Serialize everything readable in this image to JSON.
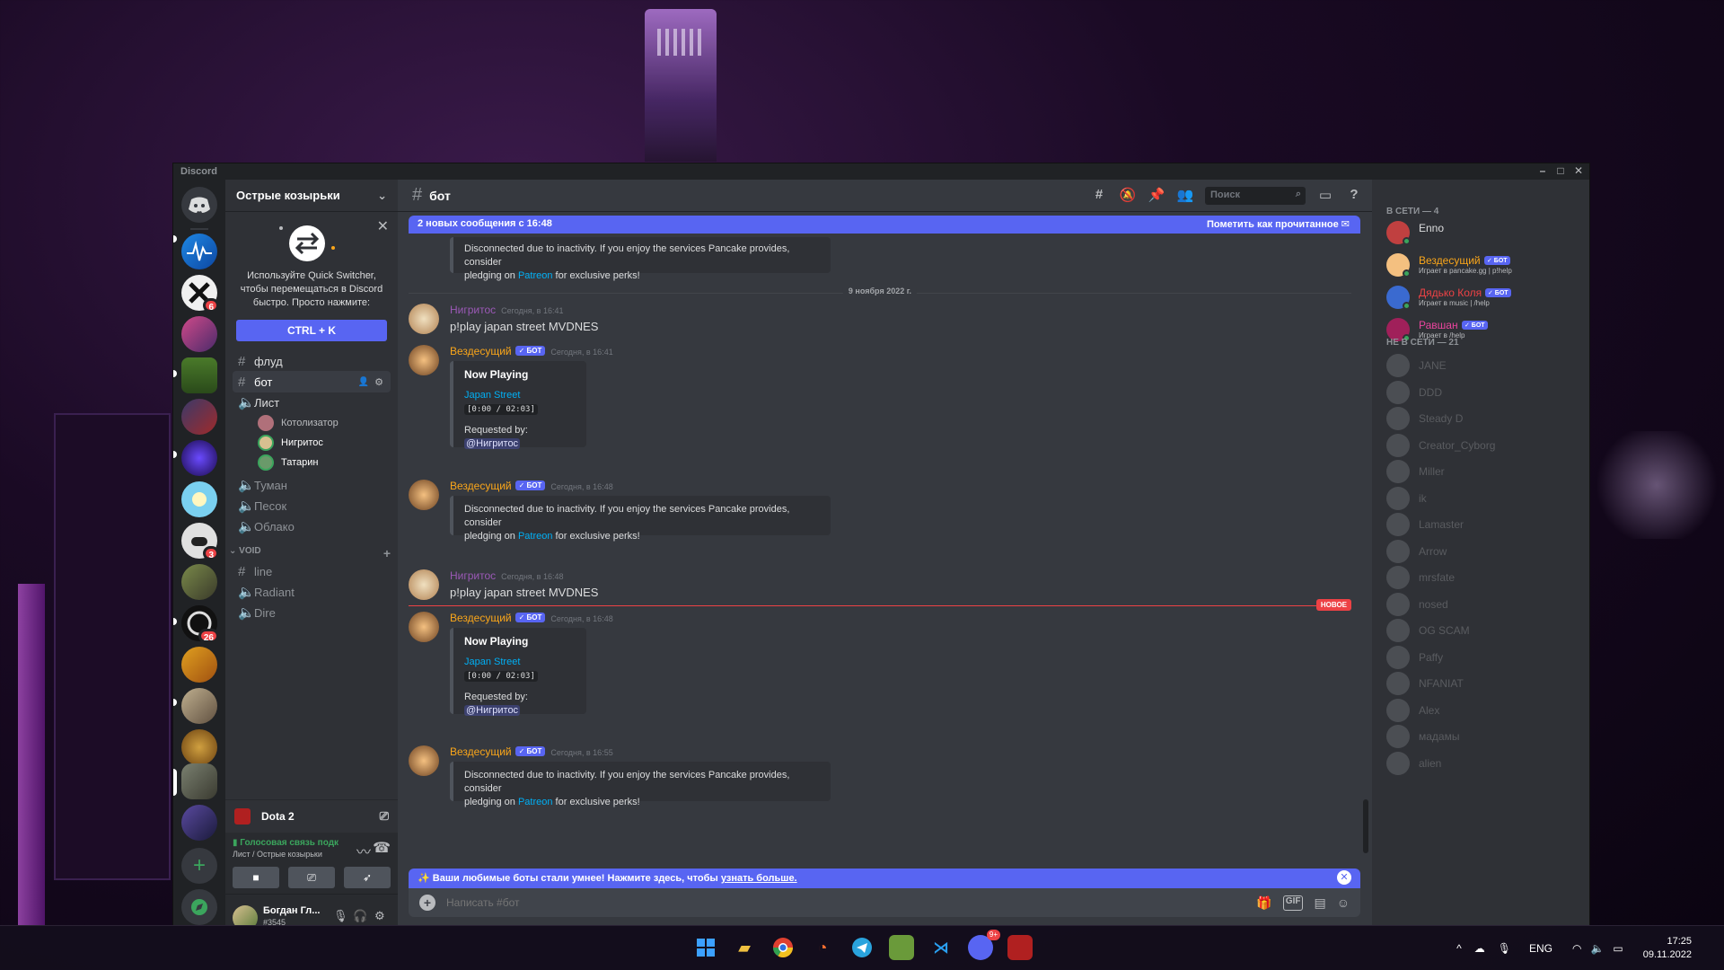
{
  "window": {
    "app_name": "Discord"
  },
  "server": {
    "name": "Острые козырьки",
    "quick_switcher": {
      "text": "Используйте Quick Switcher, чтобы перемещаться в Discord быстро. Просто нажмите:",
      "shortcut": "CTRL + K"
    },
    "channels": {
      "flood": "флуд",
      "bot": "бот",
      "list": "Лист",
      "voice_users": [
        "Котолизатор",
        "Нигритос",
        "Татарин"
      ],
      "fog": "Туман",
      "sand": "Песок",
      "cloud": "Облако"
    },
    "category_void": "VOID",
    "void_channels": [
      "line",
      "Radiant",
      "Dire"
    ]
  },
  "server_badges": {
    "s3": "6",
    "s9": "3",
    "s11": "26"
  },
  "activity": {
    "game": "Dota 2"
  },
  "voice": {
    "status": "Голосовая связь подк",
    "location": "Лист / Острые козырьки"
  },
  "user": {
    "name": "Богдан Гл...",
    "tag": "#3545"
  },
  "chat": {
    "channel": "бот",
    "search_placeholder": "Поиск",
    "new_messages_bar": "2 новых сообщения с 16:48",
    "mark_read": "Пометить как прочитанное",
    "date_divider": "9 ноября 2022 г.",
    "new_label": "НОВОЕ",
    "bot_tag": "✓ БОТ",
    "inactivity_text_1": "Disconnected due to inactivity. If you enjoy the services Pancake provides, consider",
    "inactivity_text_2a": "pledging on",
    "inactivity_link": "Patreon",
    "inactivity_text_2b": "for exclusive perks!",
    "now_playing": "Now Playing",
    "track": "Japan Street",
    "progress": "[0:00 / 02:03]",
    "requested_by": "Requested by:",
    "requester": "@Нигритос",
    "messages": [
      {
        "author": "Нигритос",
        "time": "Сегодня, в 16:41",
        "text": "p!play japan street MVDNES"
      },
      {
        "author": "Вездесущий",
        "time": "Сегодня, в 16:41"
      },
      {
        "author": "Вездесущий",
        "time": "Сегодня, в 16:48"
      },
      {
        "author": "Нигритос",
        "time": "Сегодня, в 16:48",
        "text": "p!play japan street MVDNES"
      },
      {
        "author": "Вездесущий",
        "time": "Сегодня, в 16:48"
      },
      {
        "author": "Вездесущий",
        "time": "Сегодня, в 16:55"
      }
    ],
    "promo_text": "Ваши любимые боты стали умнее! Нажмите здесь, чтобы",
    "promo_link": "узнать больше.",
    "composer_placeholder": "Написать #бот"
  },
  "members": {
    "online_header": "В СЕТИ — 4",
    "offline_header": "НЕ В СЕТИ — 21",
    "online": [
      {
        "name": "Enno",
        "status": "",
        "color": "#dcddde",
        "bot": false
      },
      {
        "name": "Вездесущий",
        "status": "Играет в pancake.gg | p!help",
        "color": "#faa61a",
        "bot": true
      },
      {
        "name": "Дядько Коля",
        "status": "Играет в music | /help",
        "color": "#ed4245",
        "bot": true
      },
      {
        "name": "Равшан",
        "status": "Играет в /help",
        "color": "#eb459e",
        "bot": true
      }
    ],
    "offline": [
      "JANE",
      "DDD",
      "Steady D",
      "Creator_Cyborg",
      "Miller",
      "ik",
      "Lamaster",
      "Arrow",
      "mrsfate",
      "nosed",
      "OG SCAM",
      "Paffy",
      "NFANIAT",
      "Alex",
      "мадамы",
      "alien"
    ]
  },
  "taskbar": {
    "lang": "ENG",
    "time": "17:25",
    "date": "09.11.2022",
    "discord_badge": "9+"
  },
  "colors": {
    "blurple": "#5865f2",
    "bot_name": "#faa61a",
    "user_name": "#9b59b6",
    "link": "#00aff4"
  }
}
